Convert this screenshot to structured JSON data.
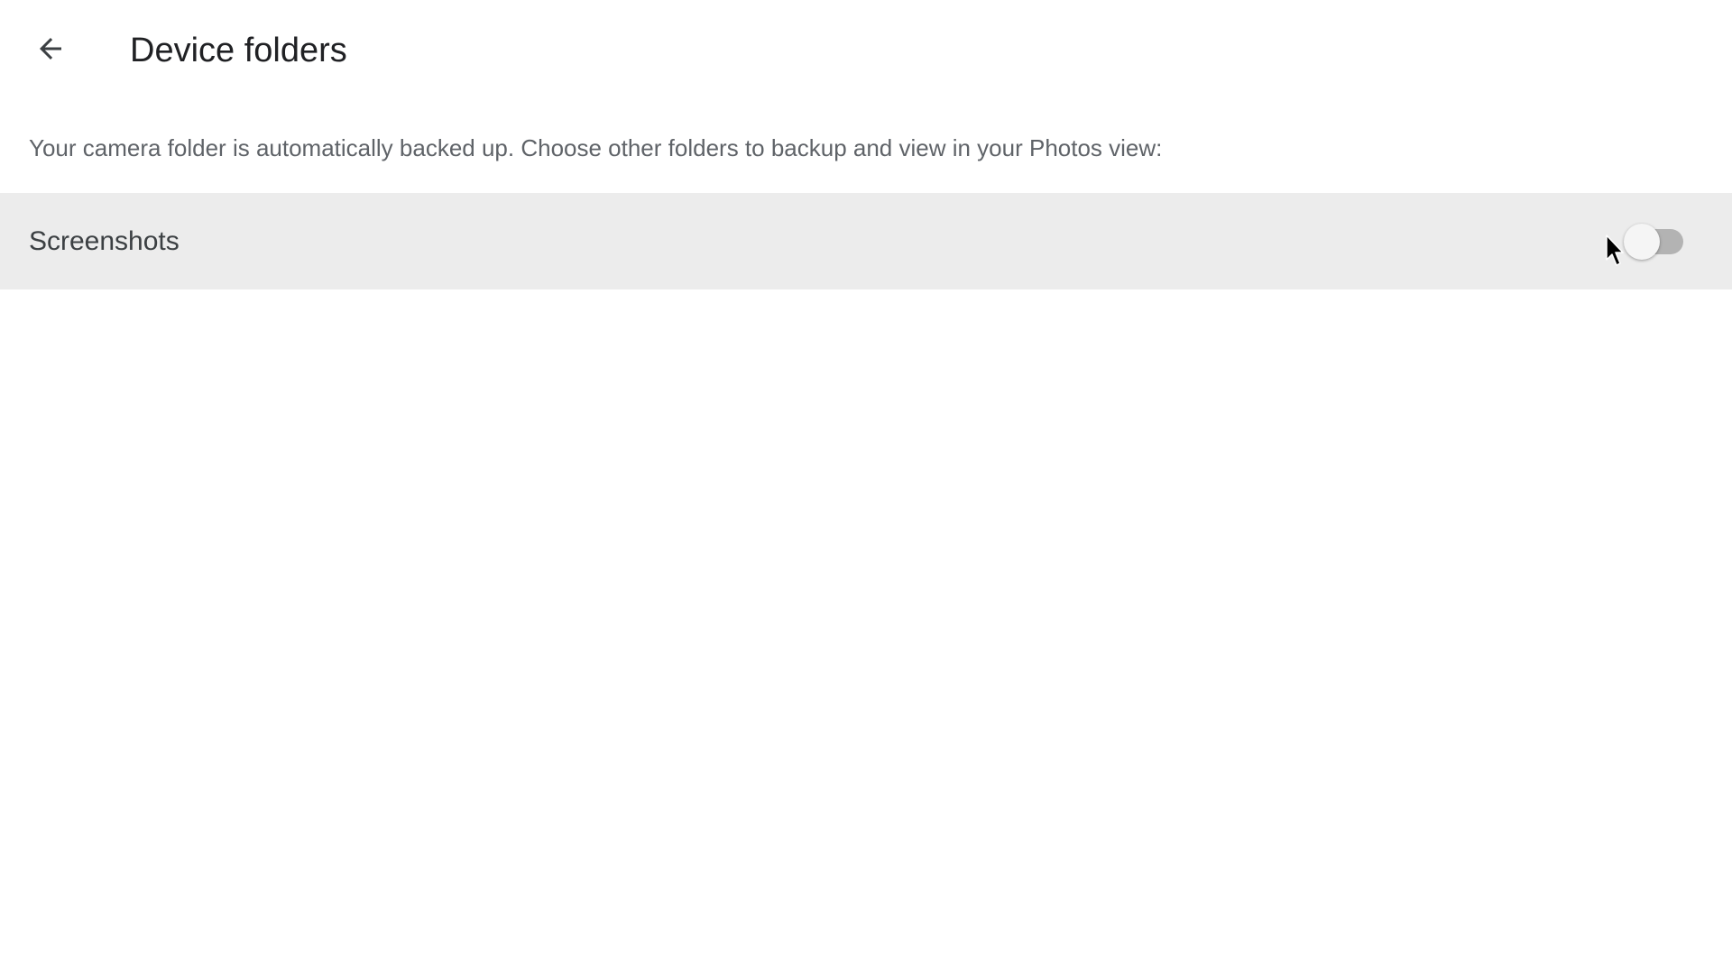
{
  "header": {
    "back_icon": "arrow-back-icon",
    "title": "Device folders"
  },
  "description": "Your camera folder is automatically backed up. Choose other folders to backup and view in your Photos view:",
  "folders": [
    {
      "label": "Screenshots",
      "backup_enabled": false
    }
  ],
  "colors": {
    "row_background": "#ececec",
    "toggle_track_off": "#b3b3b3",
    "toggle_thumb_off": "#f5f5f5",
    "description_text": "#5f6368"
  },
  "cursor_icon": "mouse-pointer-icon"
}
